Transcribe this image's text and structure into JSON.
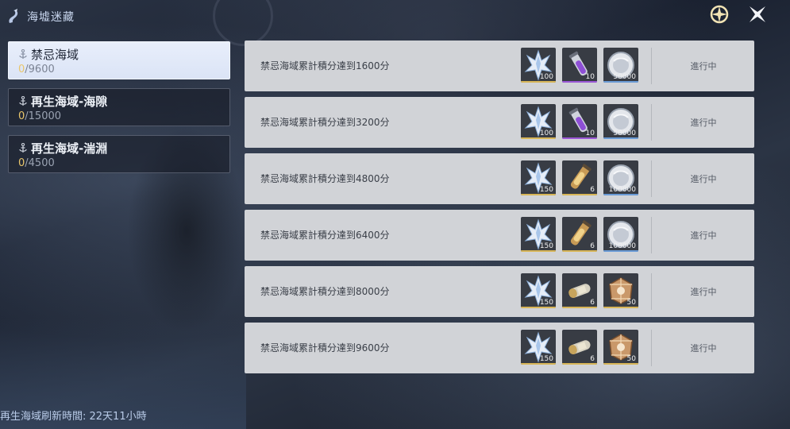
{
  "header": {
    "title": "海墟迷藏",
    "logo_icon": "sea-serpent-icon",
    "right_icons": [
      "compass-icon",
      "close-icon"
    ]
  },
  "sidebar": {
    "items": [
      {
        "name": "禁忌海域",
        "current": "0",
        "total": "/9600",
        "active": true
      },
      {
        "name": "再生海域-海隙",
        "current": "0",
        "total": "/15000",
        "active": false
      },
      {
        "name": "再生海域-湍淵",
        "current": "0",
        "total": "/4500",
        "active": false
      }
    ]
  },
  "footer": {
    "refresh_text": "再生海域刷新時間: 22天11小時"
  },
  "tasks": [
    {
      "label": "禁忌海域累計積分達到1600分",
      "status": "進行中",
      "rewards": [
        {
          "icon": "crystal-star-icon",
          "count": "100"
        },
        {
          "icon": "purple-vial-icon",
          "count": "10"
        },
        {
          "icon": "silver-coin-icon",
          "count": "50000"
        }
      ]
    },
    {
      "label": "禁忌海域累計積分達到3200分",
      "status": "進行中",
      "rewards": [
        {
          "icon": "crystal-star-icon",
          "count": "100"
        },
        {
          "icon": "purple-vial-icon",
          "count": "10"
        },
        {
          "icon": "silver-coin-icon",
          "count": "50000"
        }
      ]
    },
    {
      "label": "禁忌海域累計積分達到4800分",
      "status": "進行中",
      "rewards": [
        {
          "icon": "crystal-star-icon",
          "count": "150"
        },
        {
          "icon": "gold-vial-icon",
          "count": "6"
        },
        {
          "icon": "silver-coin-icon",
          "count": "100000"
        }
      ]
    },
    {
      "label": "禁忌海域累計積分達到6400分",
      "status": "進行中",
      "rewards": [
        {
          "icon": "crystal-star-icon",
          "count": "150"
        },
        {
          "icon": "gold-vial-icon",
          "count": "6"
        },
        {
          "icon": "silver-coin-icon",
          "count": "100000"
        }
      ]
    },
    {
      "label": "禁忌海域累計積分達到8000分",
      "status": "進行中",
      "rewards": [
        {
          "icon": "crystal-star-icon",
          "count": "150"
        },
        {
          "icon": "capsule-icon",
          "count": "6"
        },
        {
          "icon": "gem-box-icon",
          "count": "50"
        }
      ]
    },
    {
      "label": "禁忌海域累計積分達到9600分",
      "status": "進行中",
      "rewards": [
        {
          "icon": "crystal-star-icon",
          "count": "150"
        },
        {
          "icon": "capsule-icon",
          "count": "6"
        },
        {
          "icon": "gem-box-icon",
          "count": "50"
        }
      ]
    }
  ],
  "colors": {
    "progress_current": "#e9c66b",
    "rarity_blue": "#6a9bd6",
    "rarity_purple": "#9b57d6",
    "rarity_gold": "#d8b658",
    "rarity_silver": "#9aa3b0"
  }
}
